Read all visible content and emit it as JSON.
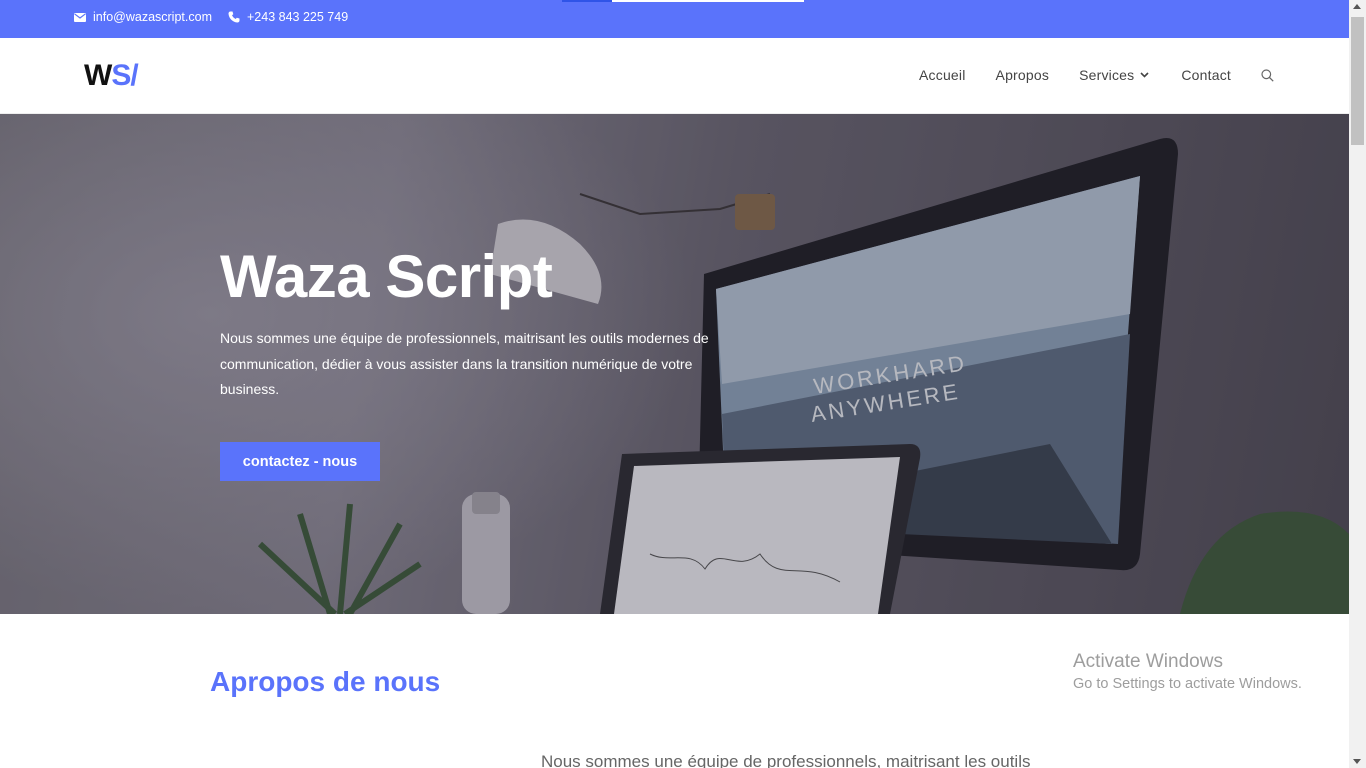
{
  "colors": {
    "accent": "#5a73fb",
    "topbar": "#5a73fb",
    "white": "#ffffff"
  },
  "topbar": {
    "email": "info@wazascript.com",
    "email_icon": "envelope-icon",
    "phone": "+243 843 225 749",
    "phone_icon": "phone-icon"
  },
  "header": {
    "logo_w": "W",
    "logo_s": "S/",
    "nav": [
      {
        "label": "Accueil"
      },
      {
        "label": "Apropos"
      },
      {
        "label": "Services"
      },
      {
        "label": "Contact"
      }
    ],
    "search_icon": "search-icon"
  },
  "hero": {
    "title": "Waza Script",
    "text": "Nous sommes une équipe de professionnels, maitrisant les outils modernes de communication, dédier à vous assister dans la transition numérique de votre business.",
    "button": "contactez - nous"
  },
  "about": {
    "title": "Apropos de nous",
    "text": "Nous sommes une équipe de professionnels, maitrisant les outils"
  },
  "watermark": {
    "line1": "Activate Windows",
    "line2": "Go to Settings to activate Windows."
  }
}
